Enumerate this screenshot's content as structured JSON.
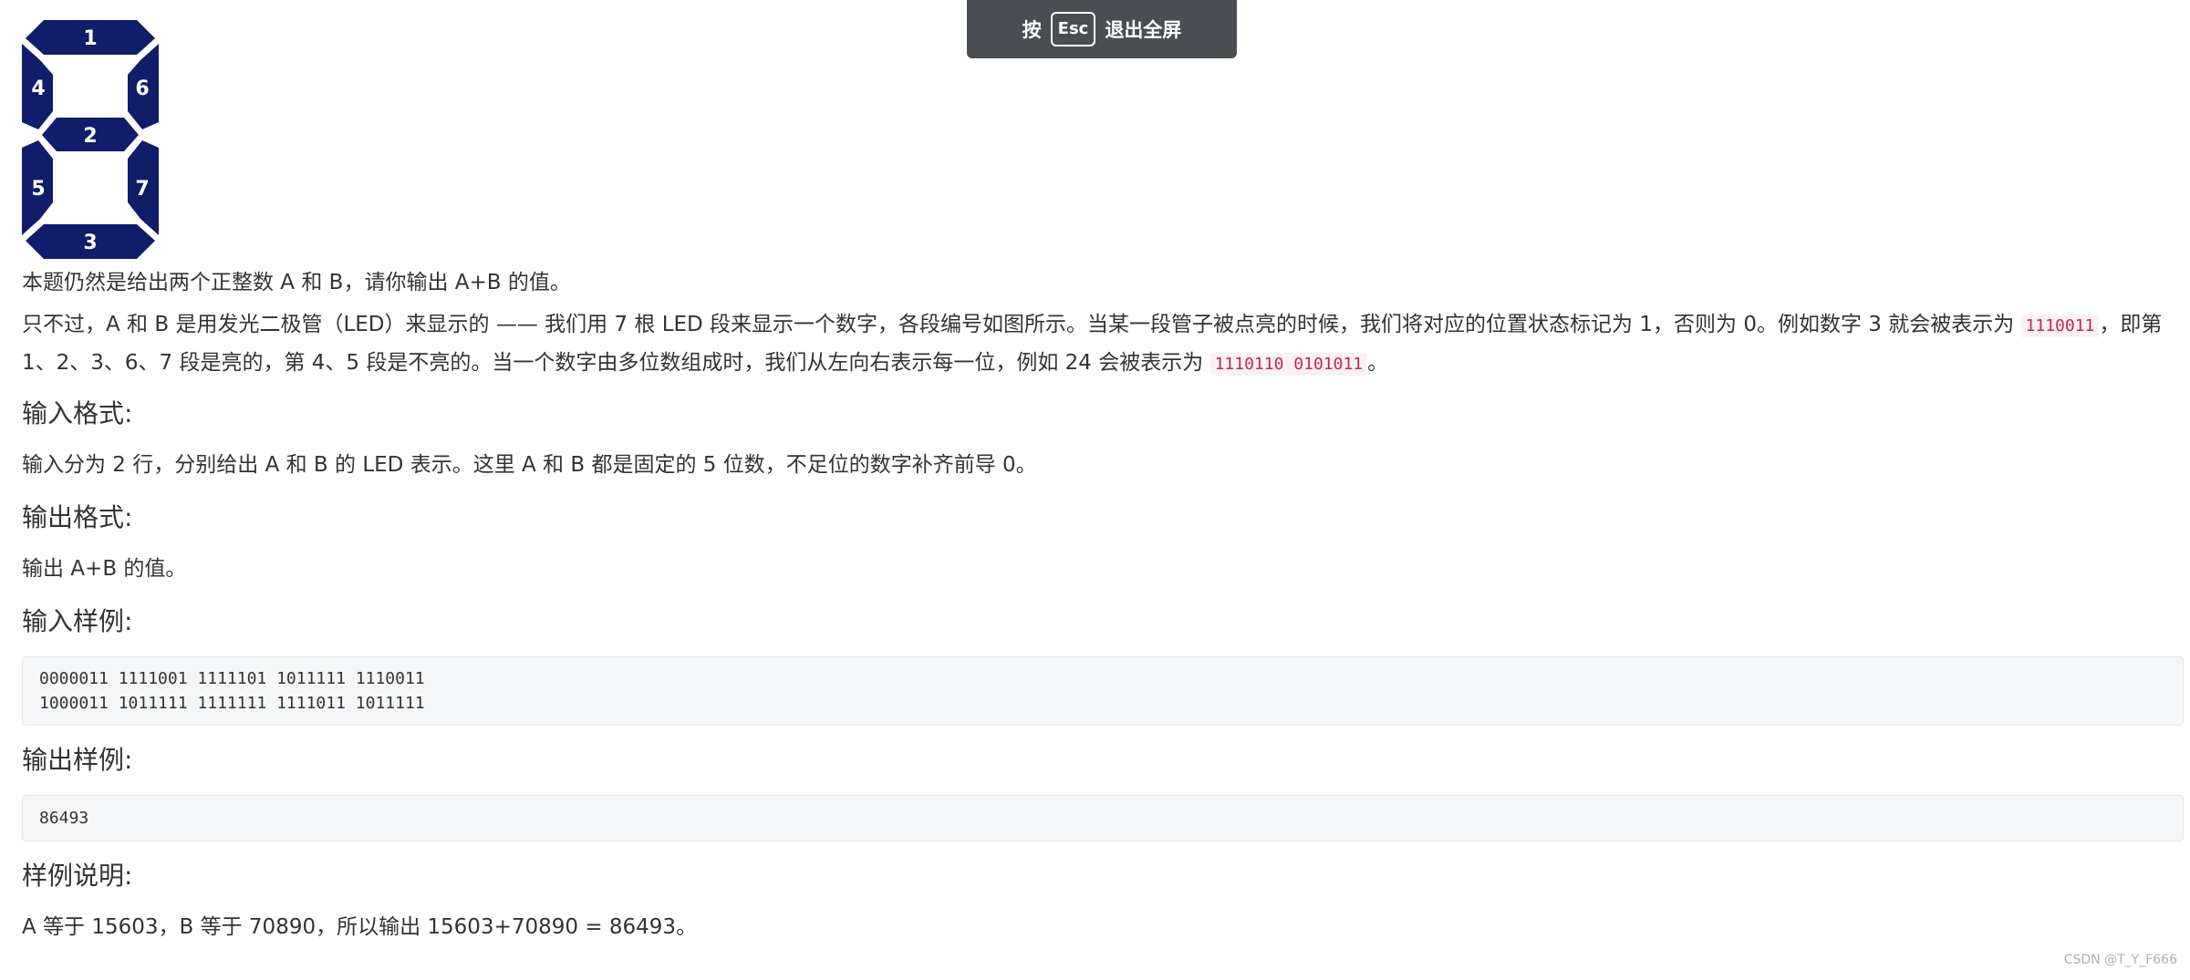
{
  "fullscreen_hint": {
    "prefix": "按",
    "key": "Esc",
    "suffix": "退出全屏"
  },
  "segment_figure": {
    "labels": {
      "top": "1",
      "middle": "2",
      "bottom": "3",
      "upper_left": "4",
      "lower_left": "5",
      "upper_right": "6",
      "lower_right": "7"
    },
    "segment_color": "#0f1d6b",
    "label_color": "#ffffff"
  },
  "problem": {
    "intro": "本题仍然是给出两个正整数 A 和 B，请你输出 A+B 的值。",
    "desc_part1": "只不过，A 和 B 是用发光二极管（LED）来显示的 —— 我们用 7 根 LED 段来显示一个数字，各段编号如图所示。当某一段管子被点亮的时候，我们将对应的位置状态标记为 1，否则为 0。例如数字 3 就会被表示为 ",
    "desc_code1": "1110011",
    "desc_part2": "，即第 1、2、3、6、7 段是亮的，第 4、5 段是不亮的。当一个数字由多位数组成时，我们从左向右表示每一位，例如 24 会被表示为 ",
    "desc_code2": "1110110 0101011",
    "desc_part3": "。",
    "input_format_title": "输入格式:",
    "input_format_text": "输入分为 2 行，分别给出 A 和 B 的 LED 表示。这里 A 和 B 都是固定的 5 位数，不足位的数字补齐前导 0。",
    "output_format_title": "输出格式:",
    "output_format_text": "输出 A+B 的值。",
    "sample_input_title": "输入样例:",
    "sample_input_line1": "0000011 1111001 1111101 1011111 1110011",
    "sample_input_line2": "1000011 1011111 1111111 1111011 1011111",
    "sample_output_title": "输出样例:",
    "sample_output": "86493",
    "explanation_title": "样例说明:",
    "explanation_text": "A 等于 15603，B 等于 70890，所以输出 15603+70890 = 86493。"
  },
  "watermark": "CSDN @T_Y_F666"
}
